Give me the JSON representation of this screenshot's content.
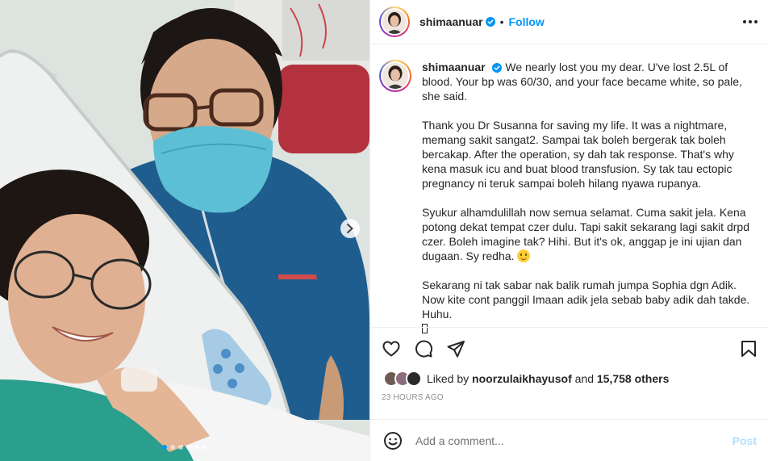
{
  "post": {
    "username": "shimaanuar",
    "verified": true,
    "follow_label": "Follow",
    "separator": "•",
    "carousel": {
      "slide_count": 6,
      "active_index": 0
    },
    "caption": {
      "paragraphs": [
        "We nearly lost you my dear. U've lost 2.5L of blood. Your bp was 60/30, and your face became white, so pale, she said.",
        "Thank you Dr Susanna for saving my life. It was a nightmare, memang sakit sangat2. Sampai tak boleh bergerak tak boleh bercakap. After the operation, sy dah tak response. That's why kena masuk icu and buat blood transfusion. Sy tak tau ectopic pregnancy ni teruk sampai boleh hilang nyawa rupanya.",
        "Syukur alhamdulillah now semua selamat. Cuma sakit jela. Kena potong dekat tempat czer dulu. Tapi sakit sekarang lagi sakit drpd czer. Boleh imagine tak? Hihi. But it's ok, anggap je ini ujian dan dugaan. Sy redha.",
        "Sekarang ni tak sabar nak balik rumah jumpa Sophia dgn Adik. Now kite cont panggil Imaan adik jela sebab baby adik dah takde. Huhu."
      ]
    },
    "likes": {
      "prefix": "Liked by",
      "user": "noorzulaikhayusof",
      "conjunction": "and",
      "others": "15,758 others"
    },
    "timestamp": "23 HOURS AGO",
    "comment": {
      "placeholder": "Add a comment...",
      "post_label": "Post"
    }
  },
  "colors": {
    "link": "#0095f6",
    "post_disabled": "#b2dffc",
    "muted": "#8e8e8e"
  },
  "icons": [
    "verified-badge-icon",
    "more-options-icon",
    "heart-icon",
    "comment-icon",
    "share-icon",
    "bookmark-icon",
    "emoji-icon",
    "chevron-right-icon",
    "smile-emoji-icon"
  ]
}
